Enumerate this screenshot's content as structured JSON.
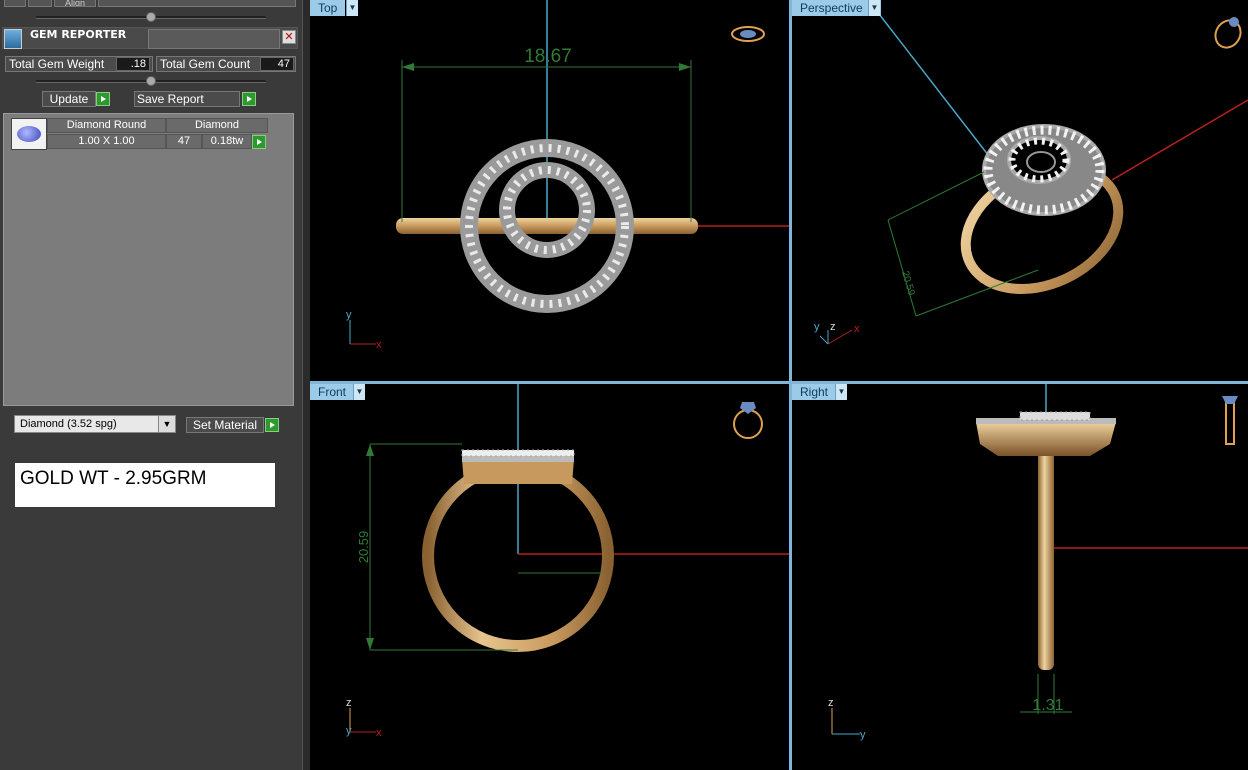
{
  "panel": {
    "top_buttons": [
      "",
      "",
      "Align",
      ""
    ],
    "title": "GEM REPORTER",
    "close_label": "✕",
    "total_gem_weight_label": "Total Gem Weight",
    "total_gem_weight_value": ".18",
    "total_gem_count_label": "Total Gem Count",
    "total_gem_count_value": "47",
    "update_label": "Update",
    "save_report_label": "Save Report",
    "gem_table": {
      "headers": [
        "Diamond Round",
        "Diamond"
      ],
      "row": {
        "size": "1.00 X 1.00",
        "count": "47",
        "weight": "0.18tw"
      }
    },
    "material_select": "Diamond    (3.52 spg)",
    "set_material_label": "Set Material",
    "note": "GOLD WT - 2.95GRM"
  },
  "viewports": {
    "top": {
      "label": "Top",
      "dimension": "18.67",
      "axis_y": "y",
      "axis_x": "x"
    },
    "perspective": {
      "label": "Perspective",
      "dimension": "20.59",
      "axis_y": "y",
      "axis_z": "z",
      "axis_x": "x"
    },
    "front": {
      "label": "Front",
      "dimension": "20.59",
      "axis_z": "z",
      "axis_y": "y",
      "axis_x": "x"
    },
    "right": {
      "label": "Right",
      "dimension": "1.31",
      "axis_z": "z",
      "axis_y": "y"
    }
  },
  "colors": {
    "gold": "#d9b27c",
    "silver": "#d0d0d0",
    "dimension_green": "#2f7a35",
    "axis_blue": "#4aa8c8",
    "axis_red": "#b82020",
    "viewport_label_bg": "#9ccbe8"
  }
}
